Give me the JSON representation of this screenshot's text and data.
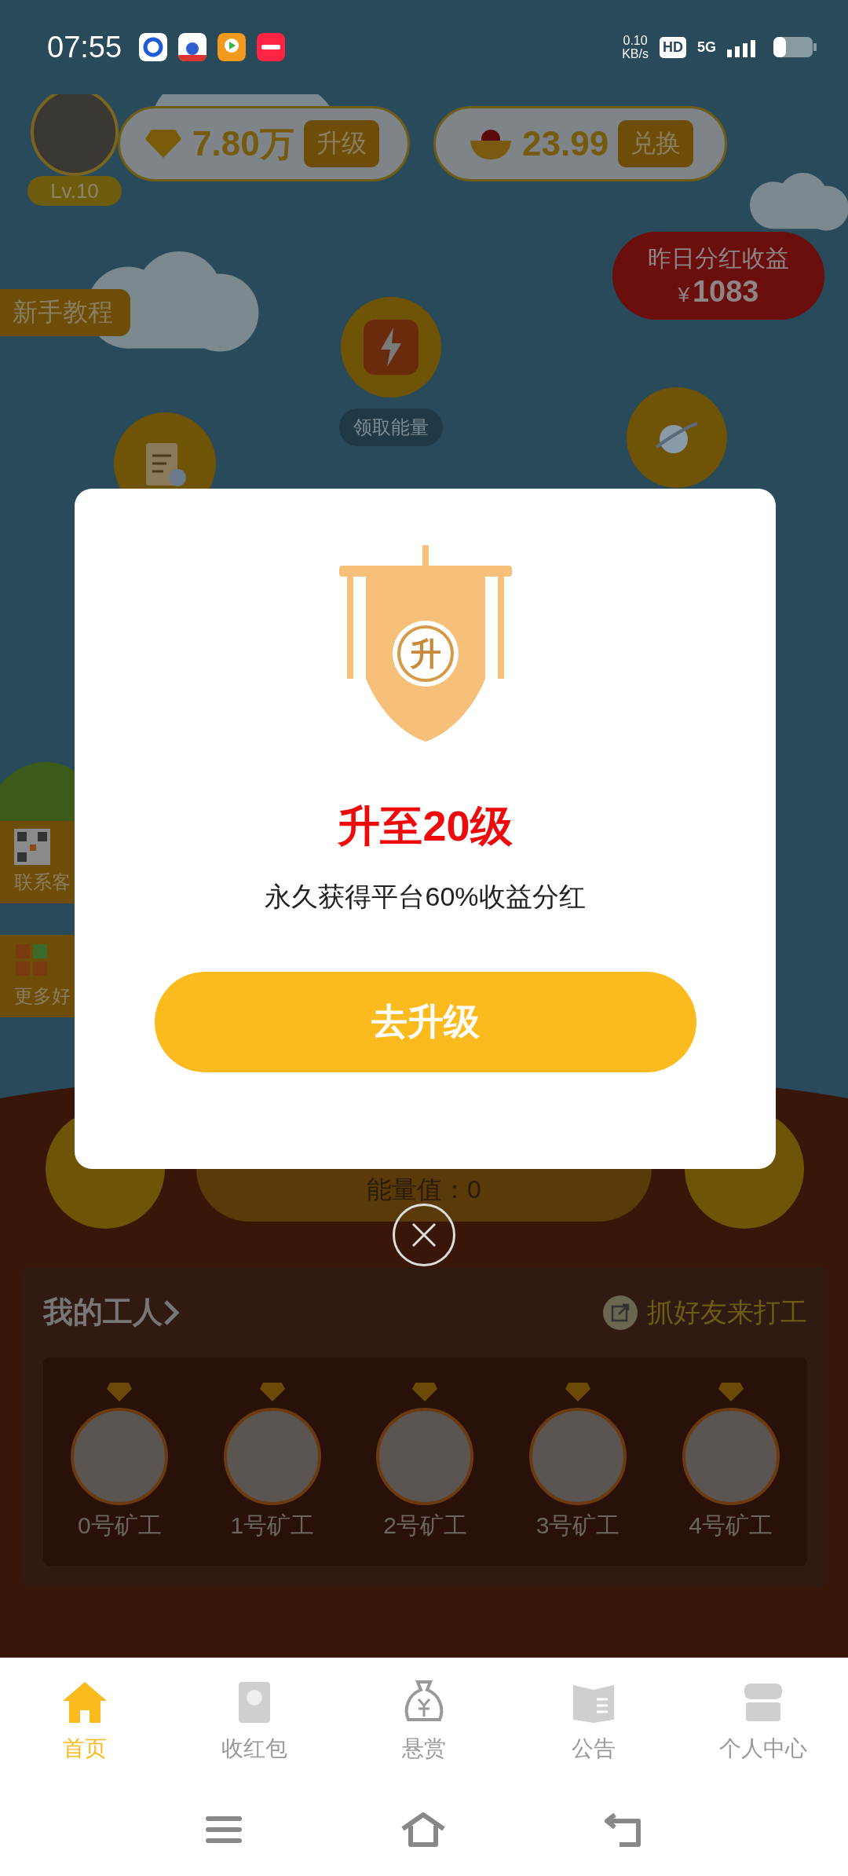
{
  "status_bar": {
    "time": "07:55",
    "net_speed": "0.10",
    "net_unit": "KB/s",
    "hd": "HD",
    "network": "5G"
  },
  "profile": {
    "level": "Lv.10"
  },
  "diamonds": {
    "value": "7.80万",
    "button": "升级"
  },
  "coins": {
    "value": "23.99",
    "button": "兑换"
  },
  "dividend": {
    "label": "昨日分红收益",
    "currency": "¥",
    "amount": "1083"
  },
  "tutorial": "新手教程",
  "energy_button": {
    "label": "领取能量"
  },
  "side_tabs": [
    {
      "label": "联系客"
    },
    {
      "label": "更多好"
    }
  ],
  "energy": {
    "reading": "能量值：0"
  },
  "modal": {
    "badge_char": "升",
    "title": "升至20级",
    "subtitle": "永久获得平台60%收益分红",
    "button": "去升级"
  },
  "workers": {
    "title": "我的工人",
    "invite": "抓好友来打工",
    "items": [
      {
        "label": "0号矿工"
      },
      {
        "label": "1号矿工"
      },
      {
        "label": "2号矿工"
      },
      {
        "label": "3号矿工"
      },
      {
        "label": "4号矿工"
      }
    ]
  },
  "nav": [
    {
      "label": "首页",
      "selected": true
    },
    {
      "label": "收红包",
      "selected": false
    },
    {
      "label": "悬赏",
      "selected": false
    },
    {
      "label": "公告",
      "selected": false
    },
    {
      "label": "个人中心",
      "selected": false
    }
  ]
}
